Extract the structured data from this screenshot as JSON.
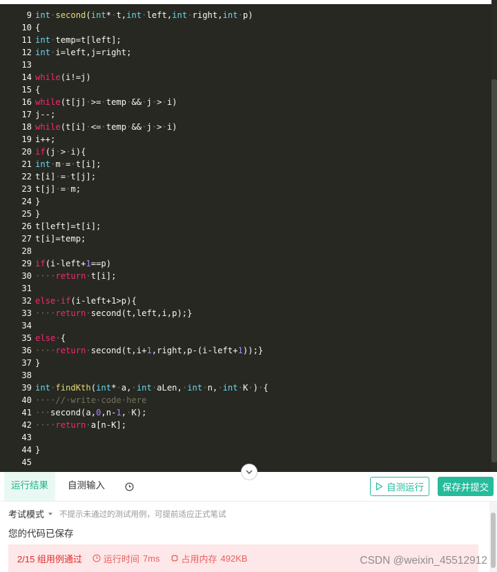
{
  "editor": {
    "lines": [
      {
        "n": "9",
        "tokens": [
          [
            "kw",
            "int"
          ],
          [
            "ws",
            "·"
          ],
          [
            "fn",
            "second"
          ],
          [
            "tx",
            "("
          ],
          [
            "kw",
            "int"
          ],
          [
            "tx",
            "*"
          ],
          [
            "ws",
            "·"
          ],
          [
            "tx",
            "t,"
          ],
          [
            "kw",
            "int"
          ],
          [
            "ws",
            "·"
          ],
          [
            "tx",
            "left,"
          ],
          [
            "kw",
            "int"
          ],
          [
            "ws",
            "·"
          ],
          [
            "tx",
            "right,"
          ],
          [
            "kw",
            "int"
          ],
          [
            "ws",
            "·"
          ],
          [
            "tx",
            "p)"
          ]
        ]
      },
      {
        "n": "10",
        "tokens": [
          [
            "tx",
            "{"
          ]
        ]
      },
      {
        "n": "11",
        "tokens": [
          [
            "kw",
            "int"
          ],
          [
            "ws",
            "·"
          ],
          [
            "tx",
            "temp=t[left];"
          ]
        ]
      },
      {
        "n": "12",
        "tokens": [
          [
            "kw",
            "int"
          ],
          [
            "ws",
            "·"
          ],
          [
            "tx",
            "i=left,j=right;"
          ]
        ]
      },
      {
        "n": "13",
        "tokens": []
      },
      {
        "n": "14",
        "tokens": [
          [
            "ctl",
            "while"
          ],
          [
            "tx",
            "(i!=j)"
          ]
        ]
      },
      {
        "n": "15",
        "tokens": [
          [
            "tx",
            "{"
          ]
        ]
      },
      {
        "n": "16",
        "tokens": [
          [
            "ctl",
            "while"
          ],
          [
            "tx",
            "(t[j]"
          ],
          [
            "ws",
            "·"
          ],
          [
            "tx",
            ">="
          ],
          [
            "ws",
            "·"
          ],
          [
            "tx",
            "temp"
          ],
          [
            "ws",
            "·"
          ],
          [
            "tx",
            "&&"
          ],
          [
            "ws",
            "·"
          ],
          [
            "tx",
            "j"
          ],
          [
            "ws",
            "·"
          ],
          [
            "tx",
            ">"
          ],
          [
            "ws",
            "·"
          ],
          [
            "tx",
            "i)"
          ]
        ]
      },
      {
        "n": "17",
        "tokens": [
          [
            "tx",
            "j--;"
          ]
        ]
      },
      {
        "n": "18",
        "tokens": [
          [
            "ctl",
            "while"
          ],
          [
            "tx",
            "(t[i]"
          ],
          [
            "ws",
            "·"
          ],
          [
            "tx",
            "<="
          ],
          [
            "ws",
            "·"
          ],
          [
            "tx",
            "temp"
          ],
          [
            "ws",
            "·"
          ],
          [
            "tx",
            "&&"
          ],
          [
            "ws",
            "·"
          ],
          [
            "tx",
            "j"
          ],
          [
            "ws",
            "·"
          ],
          [
            "tx",
            ">"
          ],
          [
            "ws",
            "·"
          ],
          [
            "tx",
            "i)"
          ]
        ]
      },
      {
        "n": "19",
        "tokens": [
          [
            "tx",
            "i++;"
          ]
        ]
      },
      {
        "n": "20",
        "tokens": [
          [
            "ctl",
            "if"
          ],
          [
            "tx",
            "(j"
          ],
          [
            "ws",
            "·"
          ],
          [
            "tx",
            ">"
          ],
          [
            "ws",
            "·"
          ],
          [
            "tx",
            "i){"
          ]
        ]
      },
      {
        "n": "21",
        "tokens": [
          [
            "kw",
            "int"
          ],
          [
            "ws",
            "·"
          ],
          [
            "tx",
            "m"
          ],
          [
            "ws",
            "·"
          ],
          [
            "tx",
            "="
          ],
          [
            "ws",
            "·"
          ],
          [
            "tx",
            "t[i];"
          ]
        ]
      },
      {
        "n": "22",
        "tokens": [
          [
            "tx",
            "t[i]"
          ],
          [
            "ws",
            "·"
          ],
          [
            "tx",
            "="
          ],
          [
            "ws",
            "·"
          ],
          [
            "tx",
            "t[j];"
          ]
        ]
      },
      {
        "n": "23",
        "tokens": [
          [
            "tx",
            "t[j]"
          ],
          [
            "ws",
            "·"
          ],
          [
            "tx",
            "="
          ],
          [
            "ws",
            "·"
          ],
          [
            "tx",
            "m;"
          ]
        ]
      },
      {
        "n": "24",
        "tokens": [
          [
            "tx",
            "}"
          ]
        ]
      },
      {
        "n": "25",
        "tokens": [
          [
            "tx",
            "}"
          ]
        ]
      },
      {
        "n": "26",
        "tokens": [
          [
            "tx",
            "t[left]=t[i];"
          ]
        ]
      },
      {
        "n": "27",
        "tokens": [
          [
            "tx",
            "t[i]=temp;"
          ]
        ]
      },
      {
        "n": "28",
        "tokens": []
      },
      {
        "n": "29",
        "tokens": [
          [
            "ctl",
            "if"
          ],
          [
            "tx",
            "(i-left+"
          ],
          [
            "num",
            "1"
          ],
          [
            "tx",
            "==p)"
          ]
        ]
      },
      {
        "n": "30",
        "tokens": [
          [
            "ws",
            "····"
          ],
          [
            "ctl",
            "return"
          ],
          [
            "ws",
            "·"
          ],
          [
            "tx",
            "t[i];"
          ]
        ]
      },
      {
        "n": "31",
        "tokens": []
      },
      {
        "n": "32",
        "tokens": [
          [
            "ctl",
            "else"
          ],
          [
            "ws",
            "·"
          ],
          [
            "ctl",
            "if"
          ],
          [
            "tx",
            "(i-left+1>p){"
          ]
        ]
      },
      {
        "n": "33",
        "tokens": [
          [
            "ws",
            "····"
          ],
          [
            "ctl",
            "return"
          ],
          [
            "ws",
            "·"
          ],
          [
            "tx",
            "second(t,left,i,p);}"
          ]
        ]
      },
      {
        "n": "34",
        "tokens": []
      },
      {
        "n": "35",
        "tokens": [
          [
            "ctl",
            "else"
          ],
          [
            "ws",
            "·"
          ],
          [
            "tx",
            "{"
          ]
        ]
      },
      {
        "n": "36",
        "tokens": [
          [
            "ws",
            "····"
          ],
          [
            "ctl",
            "return"
          ],
          [
            "ws",
            "·"
          ],
          [
            "tx",
            "second(t,i+"
          ],
          [
            "num",
            "1"
          ],
          [
            "tx",
            ",right,p-(i-left+"
          ],
          [
            "num",
            "1"
          ],
          [
            "tx",
            "));}"
          ]
        ]
      },
      {
        "n": "37",
        "tokens": [
          [
            "tx",
            "}"
          ]
        ]
      },
      {
        "n": "38",
        "tokens": []
      },
      {
        "n": "39",
        "tokens": [
          [
            "kw",
            "int"
          ],
          [
            "ws",
            "·"
          ],
          [
            "fn",
            "findKth"
          ],
          [
            "tx",
            "("
          ],
          [
            "kw",
            "int"
          ],
          [
            "tx",
            "*"
          ],
          [
            "ws",
            "·"
          ],
          [
            "tx",
            "a,"
          ],
          [
            "ws",
            "·"
          ],
          [
            "kw",
            "int"
          ],
          [
            "ws",
            "·"
          ],
          [
            "tx",
            "aLen,"
          ],
          [
            "ws",
            "·"
          ],
          [
            "kw",
            "int"
          ],
          [
            "ws",
            "·"
          ],
          [
            "tx",
            "n,"
          ],
          [
            "ws",
            "·"
          ],
          [
            "kw",
            "int"
          ],
          [
            "ws",
            "·"
          ],
          [
            "tx",
            "K"
          ],
          [
            "ws",
            "·"
          ],
          [
            "tx",
            ")"
          ],
          [
            "ws",
            "·"
          ],
          [
            "tx",
            "{"
          ]
        ]
      },
      {
        "n": "40",
        "tokens": [
          [
            "ws",
            "····"
          ],
          [
            "cm",
            "//·write·code·here"
          ]
        ]
      },
      {
        "n": "41",
        "tokens": [
          [
            "ws",
            "···"
          ],
          [
            "tx",
            "second(a,"
          ],
          [
            "num",
            "0"
          ],
          [
            "tx",
            ",n-"
          ],
          [
            "num",
            "1"
          ],
          [
            "tx",
            ","
          ],
          [
            "ws",
            "·"
          ],
          [
            "tx",
            "K);"
          ]
        ]
      },
      {
        "n": "42",
        "tokens": [
          [
            "ws",
            "····"
          ],
          [
            "ctl",
            "return"
          ],
          [
            "ws",
            "·"
          ],
          [
            "tx",
            "a[n-K];"
          ]
        ]
      },
      {
        "n": "43",
        "tokens": []
      },
      {
        "n": "44",
        "tokens": [
          [
            "tx",
            "}"
          ]
        ]
      },
      {
        "n": "45",
        "tokens": []
      }
    ]
  },
  "tabs": {
    "result": "运行结果",
    "input": "自测输入",
    "history_icon": "clock-icon"
  },
  "actions": {
    "self_test": "自测运行",
    "submit": "保存并提交"
  },
  "result": {
    "mode_label": "考试模式",
    "mode_hint": "不提示未通过的测试用例，可提前适应正式笔试",
    "saved_message": "您的代码已保存",
    "pass_count": "2/15 组用例通过",
    "runtime_label": "运行时间",
    "runtime_value": "7ms",
    "memory_label": "占用内存",
    "memory_value": "492KB"
  },
  "watermark": "CSDN @weixin_45512912",
  "colors": {
    "accent": "#25bb9b",
    "error": "#e22a2a",
    "editor_bg": "#272822"
  }
}
